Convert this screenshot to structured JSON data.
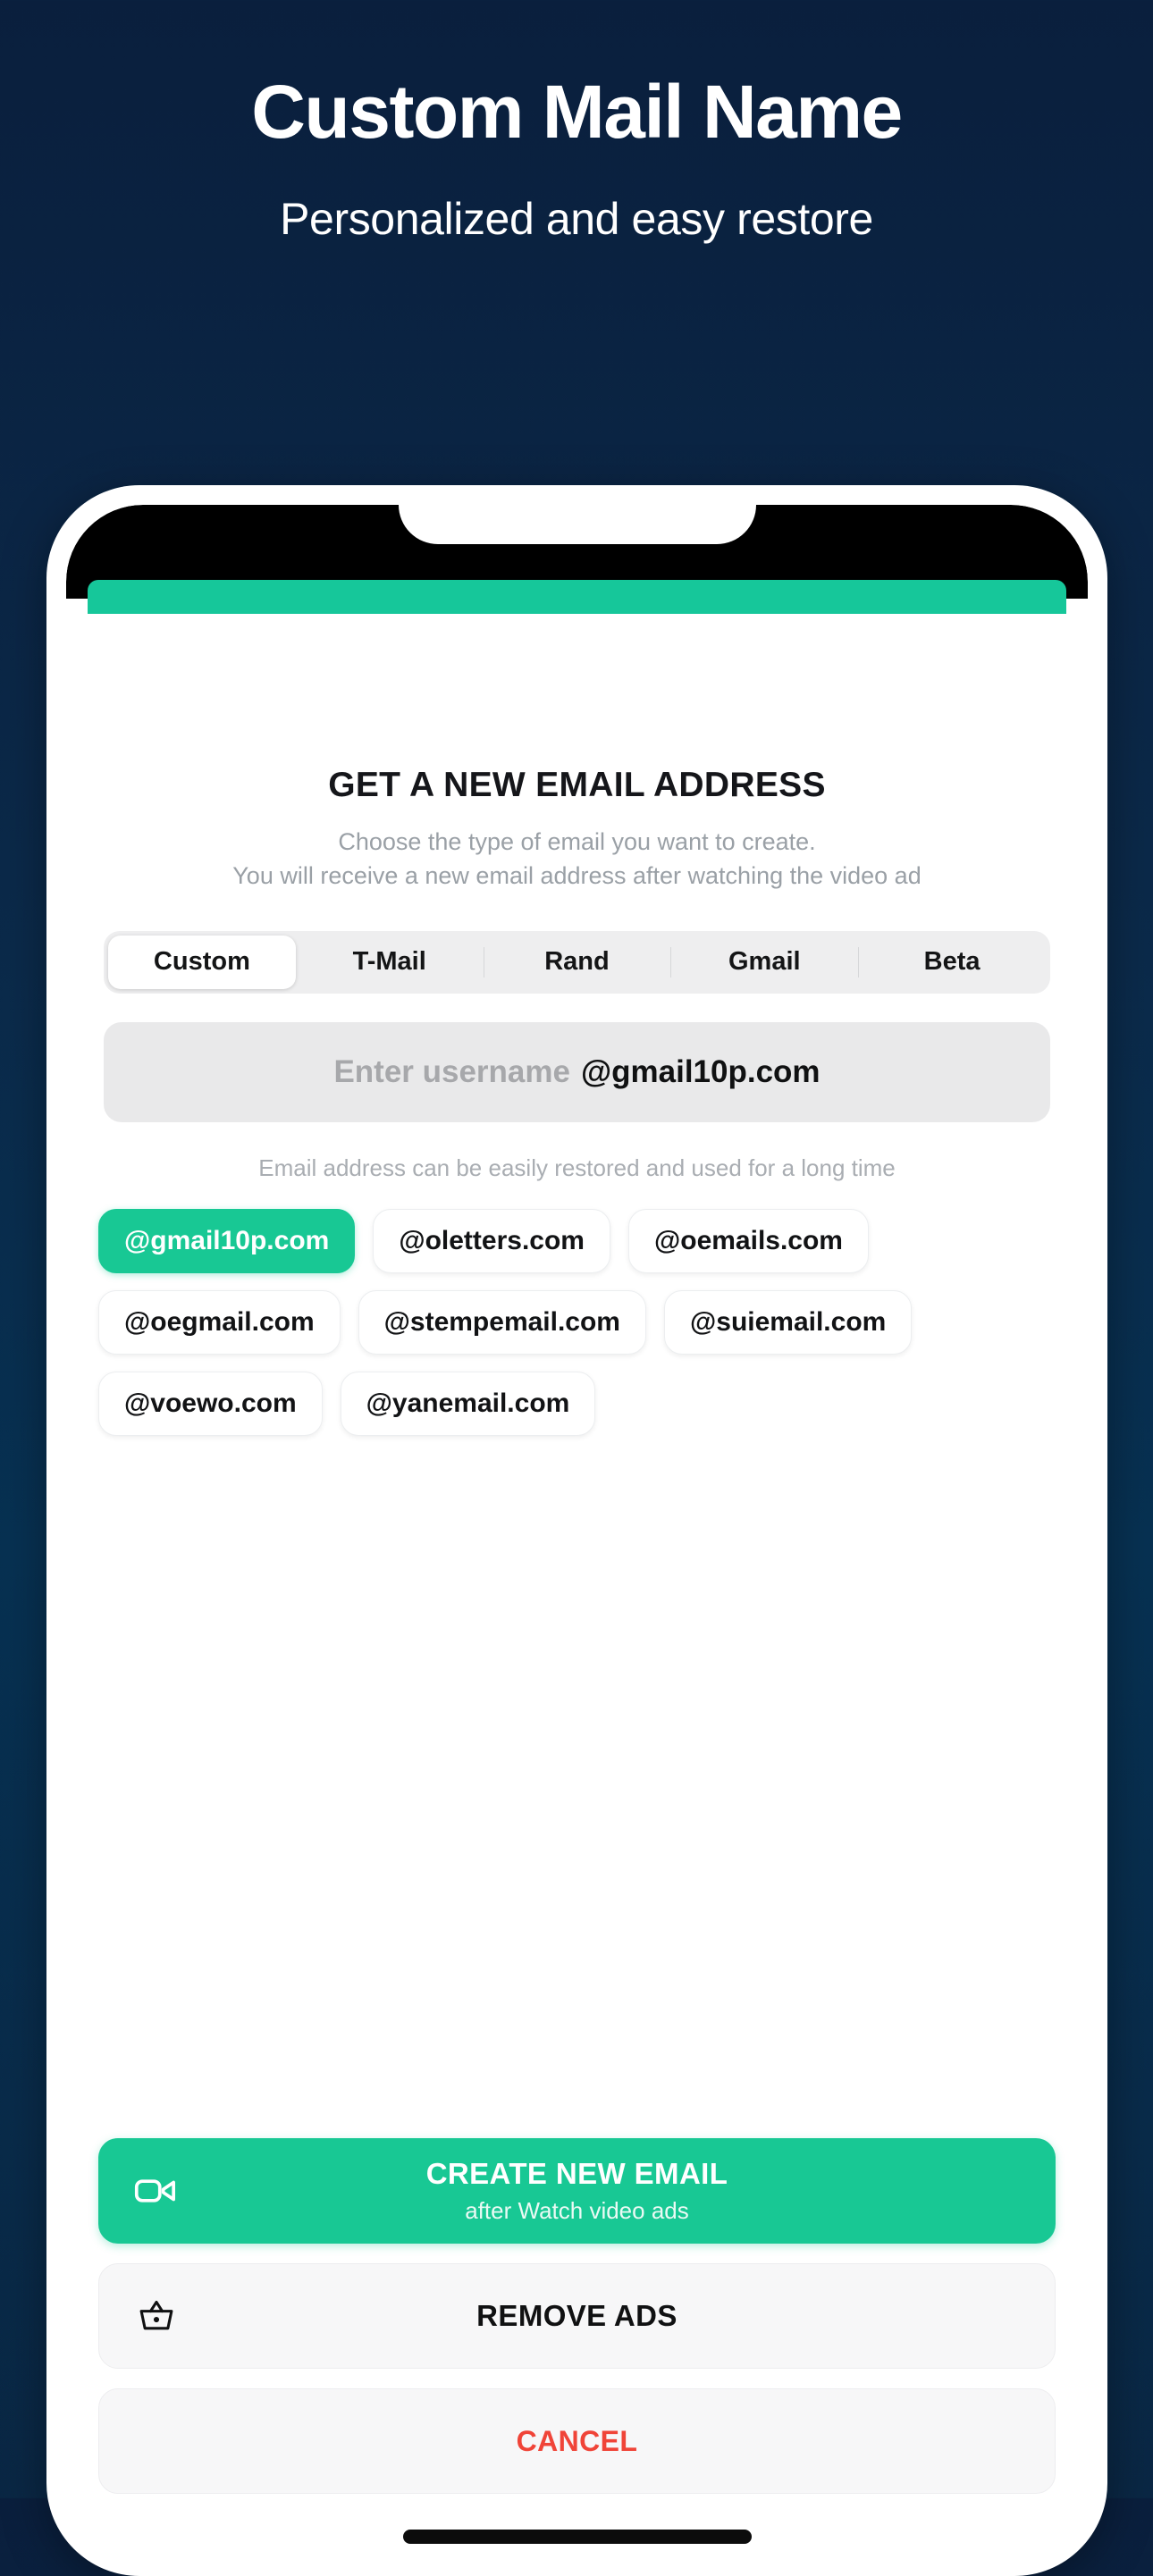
{
  "promo": {
    "title": "Custom Mail Name",
    "subtitle": "Personalized and easy restore",
    "background_color": "#0a2744",
    "accent_color": "#16c79a"
  },
  "sheet": {
    "title": "GET A NEW EMAIL ADDRESS",
    "description_line1": "Choose the type of email you want to create.",
    "description_line2": "You will receive a new email address after watching the video ad",
    "tabs": [
      {
        "label": "Custom",
        "active": true
      },
      {
        "label": "T-Mail",
        "active": false
      },
      {
        "label": "Rand",
        "active": false
      },
      {
        "label": "Gmail",
        "active": false
      },
      {
        "label": "Beta",
        "active": false
      }
    ],
    "username_input": {
      "value": "",
      "placeholder": "Enter username",
      "suffix": "@gmail10p.com"
    },
    "hint": "Email address can be easily restored and used for a long time",
    "domains": [
      {
        "label": "@gmail10p.com",
        "selected": true
      },
      {
        "label": "@oletters.com",
        "selected": false
      },
      {
        "label": "@oemails.com",
        "selected": false
      },
      {
        "label": "@oegmail.com",
        "selected": false
      },
      {
        "label": "@stempemail.com",
        "selected": false
      },
      {
        "label": "@suiemail.com",
        "selected": false
      },
      {
        "label": "@voewo.com",
        "selected": false
      },
      {
        "label": "@yanemail.com",
        "selected": false
      }
    ],
    "actions": {
      "create": {
        "primary_label": "CREATE NEW EMAIL",
        "secondary_label": "after Watch video ads",
        "icon": "video-camera-icon",
        "color": "#18c894"
      },
      "remove_ads": {
        "label": "REMOVE ADS",
        "icon": "shopping-basket-icon"
      },
      "cancel": {
        "label": "CANCEL",
        "color": "#f04438"
      }
    }
  }
}
